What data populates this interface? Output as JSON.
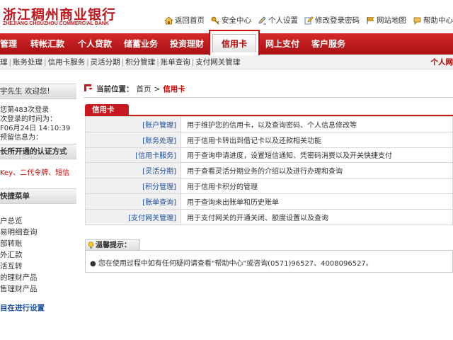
{
  "brand": {
    "name_cn": "浙江稠州商业银行",
    "name_en": "ZHEJIANG CHOUZHOU COMMERCIAL BANK",
    "colors": {
      "primary": "#c0161c",
      "nav": "#b71418",
      "link": "#1a4da0"
    }
  },
  "top_links": [
    {
      "label": "返回首页",
      "icon": "home-icon"
    },
    {
      "label": "安全中心",
      "icon": "key-icon"
    },
    {
      "label": "个人设置",
      "icon": "pencil-icon"
    },
    {
      "label": "修改登录密码",
      "icon": "edit-icon"
    },
    {
      "label": "网站地图",
      "icon": "flag-icon"
    },
    {
      "label": "帮助中心",
      "icon": "help-icon"
    }
  ],
  "nav": {
    "items": [
      "管理",
      "转帐汇款",
      "个人贷款",
      "储蓄业务",
      "投资理财",
      "信用卡",
      "网上支付",
      "客户服务"
    ],
    "active": "信用卡"
  },
  "subnav": {
    "items": [
      "理",
      "账务处理",
      "信用卡服务",
      "灵活分期",
      "积分管理",
      "账单查询",
      "支付网关管理"
    ],
    "right": "个人网"
  },
  "sidebar": {
    "welcome": "宇先生 欢迎您!",
    "login_info": [
      "您第483次登录",
      "次登录的时间为：",
      "F06月24日 14:10:39",
      "预留信息为："
    ],
    "auth_title": "长所开通的认证方式",
    "auth_methods": "Key、二代令牌、短信",
    "quick_menu_title": "快捷菜单",
    "quick_links": [
      "户总览",
      "易明细查询",
      "部转账",
      "外汇款",
      "活互转",
      "的理财产品",
      "售理财产品"
    ],
    "progress_link": "目在进行设置"
  },
  "breadcrumb": {
    "label": "当前位置：",
    "home": "首页",
    "separator": ">",
    "current": "信用卡"
  },
  "section_title": "信用卡",
  "services": [
    {
      "name": "[账户管理]",
      "desc": "用于维护您的信用卡，以及查询密码、个人信息修改等"
    },
    {
      "name": "[账务处理]",
      "desc": "用于信用卡转出到借记卡以及还款相关功能"
    },
    {
      "name": "[信用卡服务]",
      "desc": "用于查询申请进度，设置短信通知、凭密码消费以及开关快捷支付"
    },
    {
      "name": "[灵活分期]",
      "desc": "用于查看灵活分期业务的介绍以及进行办理和查询"
    },
    {
      "name": "[积分管理]",
      "desc": "用于信用卡积分的管理"
    },
    {
      "name": "[账单查询]",
      "desc": "用于查询未出账单和历史账单"
    },
    {
      "name": "[支付网关管理]",
      "desc": "用于支付网关的开通关闭、额度设置以及查询"
    }
  ],
  "tips": {
    "title": "温馨提示：",
    "text": "●  您在使用过程中如有任何疑问请查看\"帮助中心\"或咨询(0571)96527、4008096527。"
  }
}
